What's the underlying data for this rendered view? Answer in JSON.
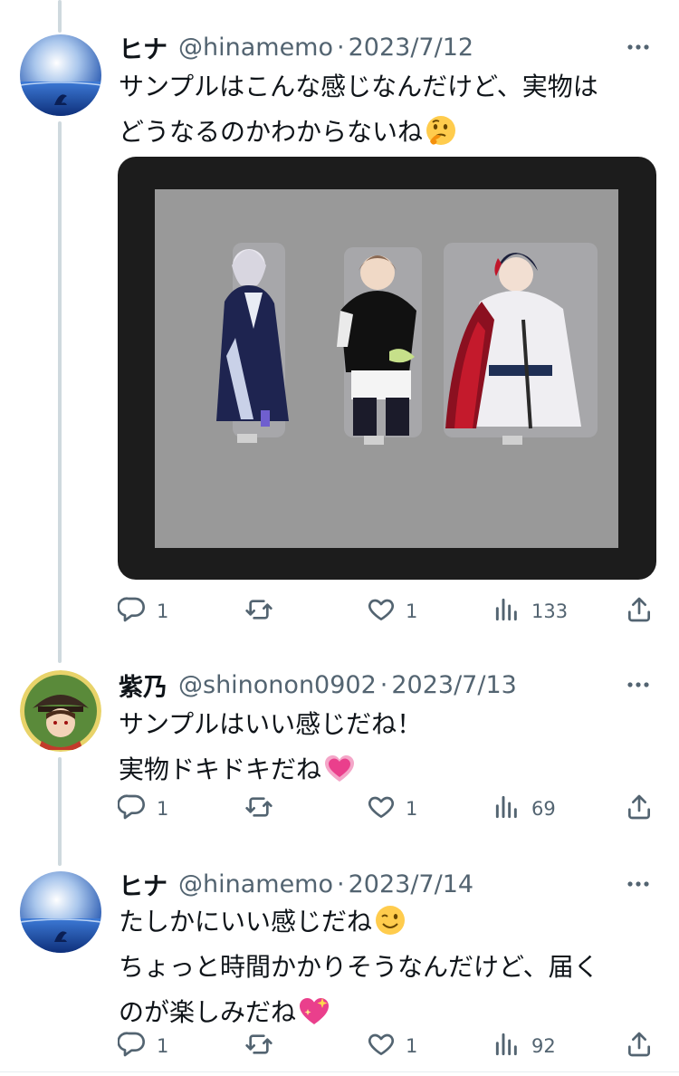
{
  "tweets": [
    {
      "name": "ヒナ",
      "handle": "@hinamemo",
      "separator": "·",
      "date": "2023/7/12",
      "text_lines": [
        "サンプルはこんな感じなんだけど、実物は",
        "どうなるのかわからないね"
      ],
      "emoji": "thinking-face",
      "replies": "1",
      "retweets": "",
      "likes": "1",
      "views": "133"
    },
    {
      "name": "紫乃",
      "handle": "@shinonon0902",
      "separator": "·",
      "date": "2023/7/13",
      "text_lines": [
        "サンプルはいい感じだね！",
        "実物ドキドキだね"
      ],
      "emoji": "growing-heart",
      "replies": "1",
      "retweets": "",
      "likes": "1",
      "views": "69"
    },
    {
      "name": "ヒナ",
      "handle": "@hinamemo",
      "separator": "·",
      "date": "2023/7/14",
      "text_lines": [
        "たしかにいい感じだね",
        "ちょっと時間かかりそうなんだけど、届く",
        "のが楽しみだね"
      ],
      "emoji": [
        "winking-face",
        "sparkling-heart"
      ],
      "replies": "1",
      "retweets": "",
      "likes": "1",
      "views": "92"
    }
  ],
  "media": {
    "description": "acrylic-stand-sample-three-characters"
  },
  "icons": {
    "reply": "reply-icon",
    "retweet": "retweet-icon",
    "like": "like-icon",
    "views": "views-icon",
    "share": "share-icon",
    "more": "more-icon"
  },
  "colors": {
    "text": "#0f1419",
    "secondary": "#536471",
    "thread_line": "#cfd9de"
  }
}
